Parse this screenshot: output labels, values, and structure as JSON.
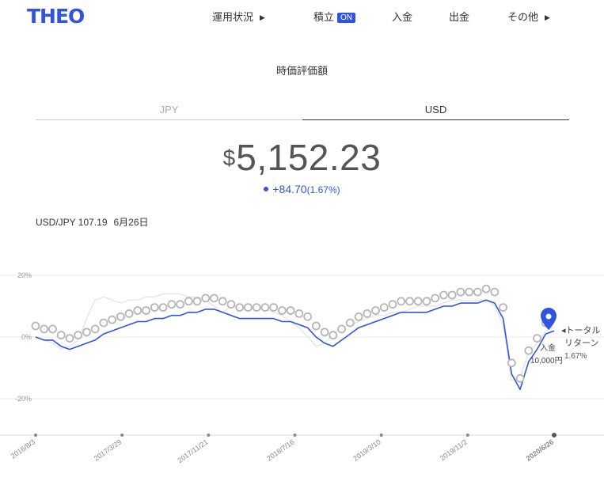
{
  "brand": "THEO",
  "nav": {
    "portfolio": "運用状況",
    "tsumitate": "積立",
    "tsumitate_badge": "ON",
    "deposit": "入金",
    "withdraw": "出金",
    "other": "その他"
  },
  "page_title": "時価評価額",
  "tabs": {
    "jpy": "JPY",
    "usd": "USD",
    "active": "USD"
  },
  "valuation": {
    "currency_symbol": "$",
    "amount": "5,152.23"
  },
  "change": {
    "value": "+84.70",
    "percent": "(1.67%)"
  },
  "fx": {
    "pair_rate": "USD/JPY 107.19",
    "date": "6月26日"
  },
  "annotations": {
    "total_return_label_1": "◂トータル",
    "total_return_label_2": "リターン",
    "total_return_value": "1.67%",
    "deposit_label": "入金",
    "deposit_value": "10,000円"
  },
  "colors": {
    "accent": "#2f55e0",
    "benchmark": "#dfe2e8",
    "marker": "#b5b5b5"
  },
  "chart_data": {
    "type": "line",
    "ylim": [
      -25,
      25
    ],
    "yticks": [
      "20%",
      "0%",
      "-20%"
    ],
    "xticks": [
      "2016/8/3",
      "2017/3/29",
      "2017/11/21",
      "2018/7/16",
      "2019/3/10",
      "2019/11/2",
      "2020/6/26"
    ],
    "series": [
      {
        "values": [
          0,
          -1,
          -1,
          -3,
          -4,
          -3,
          -2,
          -1,
          1,
          2,
          3,
          4,
          5,
          5,
          6,
          6,
          7,
          7,
          8,
          8,
          9,
          9,
          8,
          7,
          6,
          6,
          6,
          6,
          6,
          5,
          5,
          4,
          3,
          0,
          -2,
          -3,
          -1,
          1,
          3,
          4,
          5,
          6,
          7,
          8,
          8,
          8,
          8,
          9,
          10,
          10,
          11,
          11,
          11,
          12,
          11,
          6,
          -12,
          -17,
          -8,
          -4,
          1,
          2
        ]
      },
      {
        "values": [
          0,
          -1,
          -2,
          -4,
          -3,
          -1,
          6,
          12,
          13,
          12,
          11,
          12,
          12,
          13,
          13,
          14,
          14,
          14,
          13,
          13,
          12,
          10,
          8,
          10,
          10,
          10,
          9,
          9,
          8,
          7,
          5,
          3,
          0,
          -3,
          -2,
          1,
          3,
          4,
          5,
          6,
          7,
          7,
          8,
          8,
          9,
          10,
          10,
          10,
          11,
          12,
          12,
          12,
          12,
          12,
          10,
          4,
          -14,
          -13,
          -5,
          -2,
          2,
          3
        ]
      }
    ],
    "highlight_date": "2020/6/26"
  }
}
